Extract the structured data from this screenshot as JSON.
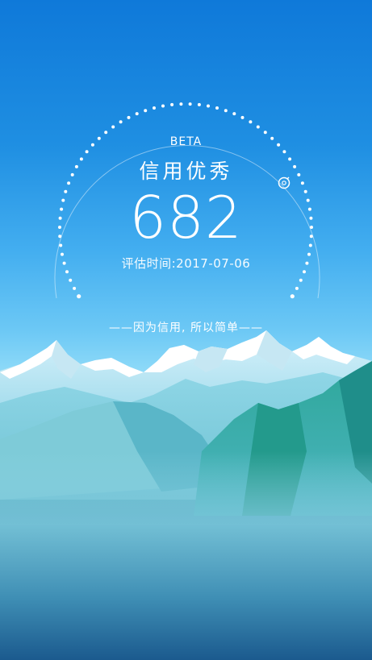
{
  "header": {
    "badge": "BETA",
    "level": "信用优秀"
  },
  "score": {
    "value": "682",
    "eval_time": "评估时间:2017-07-06"
  },
  "gauge": {
    "level_fraction": 1.0
  },
  "slogan": "——因为信用, 所以简单——",
  "icons": {
    "gauge_marker": "info-icon"
  },
  "colors": {
    "sky_top": "#0f79d9",
    "sky_mid": "#6cc8f5",
    "text": "#ffffff",
    "snow": "#ffffff",
    "mountain_teal": "#2ea79a"
  }
}
